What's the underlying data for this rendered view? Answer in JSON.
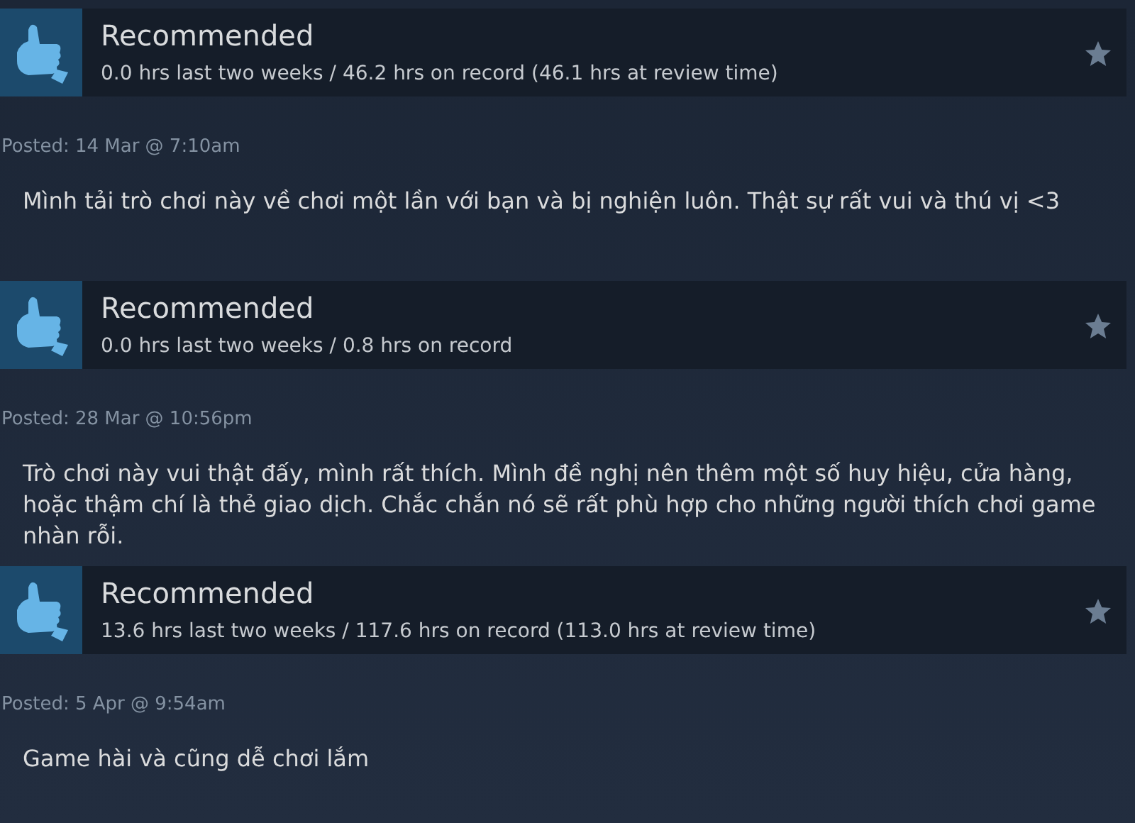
{
  "reviews": [
    {
      "verdict": "Recommended",
      "hours": "0.0 hrs last two weeks / 46.2 hrs on record (46.1 hrs at review time)",
      "posted": "Posted: 14 Mar @ 7:10am",
      "text": "Mình tải trò chơi này về chơi một lần với bạn và bị nghiện luôn. Thật sự rất  vui và thú vị <3"
    },
    {
      "verdict": "Recommended",
      "hours": "0.0 hrs last two weeks / 0.8 hrs on record",
      "posted": "Posted: 28 Mar @ 10:56pm",
      "text": "Trò chơi này vui thật đấy, mình rất thích. Mình đề nghị nên thêm một số huy hiệu, cửa hàng, hoặc thậm chí là thẻ giao dịch. Chắc chắn nó sẽ rất phù hợp cho những người thích chơi game nhàn rỗi."
    },
    {
      "verdict": "Recommended",
      "hours": "13.6 hrs last two weeks / 117.6 hrs on record (113.0 hrs at review time)",
      "posted": "Posted: 5 Apr @ 9:54am",
      "text": "Game hài và cũng dễ chơi lắm"
    }
  ]
}
